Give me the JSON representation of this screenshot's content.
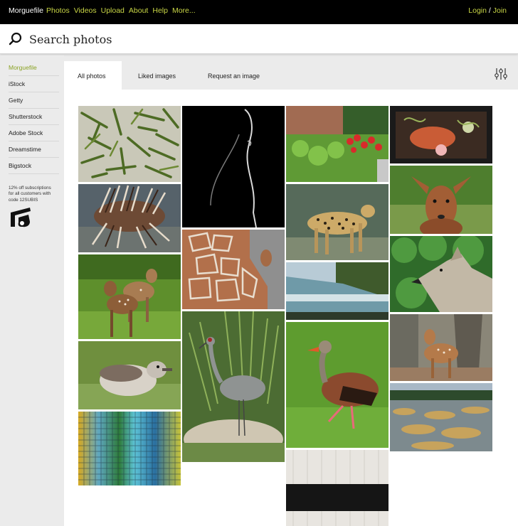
{
  "nav": {
    "brand": "Morguefile",
    "links": [
      "Photos",
      "Videos",
      "Upload",
      "About",
      "Help",
      "More..."
    ],
    "login": "Login",
    "separator": "/",
    "join": "Join",
    "accent_color": "#c9d646"
  },
  "search": {
    "placeholder": "Search photos",
    "icon": "search-icon"
  },
  "sidebar": {
    "items": [
      {
        "label": "Morguefile",
        "active": true
      },
      {
        "label": "iStock"
      },
      {
        "label": "Getty"
      },
      {
        "label": "Shutterstock"
      },
      {
        "label": "Adobe Stock"
      },
      {
        "label": "Dreamstime"
      },
      {
        "label": "Bigstock"
      }
    ],
    "promo": {
      "line1": "12% off subscriptions",
      "line2": "for all customers with",
      "line3": "code 12SUBIS",
      "logo": "shutterstock-logo"
    },
    "active_color": "#8aa223"
  },
  "tabs": [
    {
      "label": "All photos",
      "active": true
    },
    {
      "label": "Liked images"
    },
    {
      "label": "Request an image"
    }
  ],
  "filter_icon": "filter-sliders-icon",
  "photos": [
    {
      "name": "photo-green-beans",
      "subject": "green-beans"
    },
    {
      "name": "photo-lionfish",
      "subject": "lionfish"
    },
    {
      "name": "photo-fawns-grass",
      "subject": "fawns"
    },
    {
      "name": "photo-duckling",
      "subject": "duckling"
    },
    {
      "name": "photo-glass-mosaic",
      "subject": "mosaic"
    },
    {
      "name": "photo-woman-silhouette",
      "subject": "silhouette"
    },
    {
      "name": "photo-giraffes",
      "subject": "giraffes"
    },
    {
      "name": "photo-crane",
      "subject": "crane"
    },
    {
      "name": "photo-garden-flowers",
      "subject": "garden"
    },
    {
      "name": "photo-cheetah",
      "subject": "cheetah"
    },
    {
      "name": "photo-river",
      "subject": "river"
    },
    {
      "name": "photo-whistling-duck",
      "subject": "duck"
    },
    {
      "name": "photo-striped-fabric",
      "subject": "fabric"
    },
    {
      "name": "photo-food-plate",
      "subject": "food"
    },
    {
      "name": "photo-deer-head",
      "subject": "deer"
    },
    {
      "name": "photo-coyote",
      "subject": "coyote"
    },
    {
      "name": "photo-fawn-tree",
      "subject": "fawn-tree"
    },
    {
      "name": "photo-marsh-landscape",
      "subject": "marsh"
    }
  ]
}
